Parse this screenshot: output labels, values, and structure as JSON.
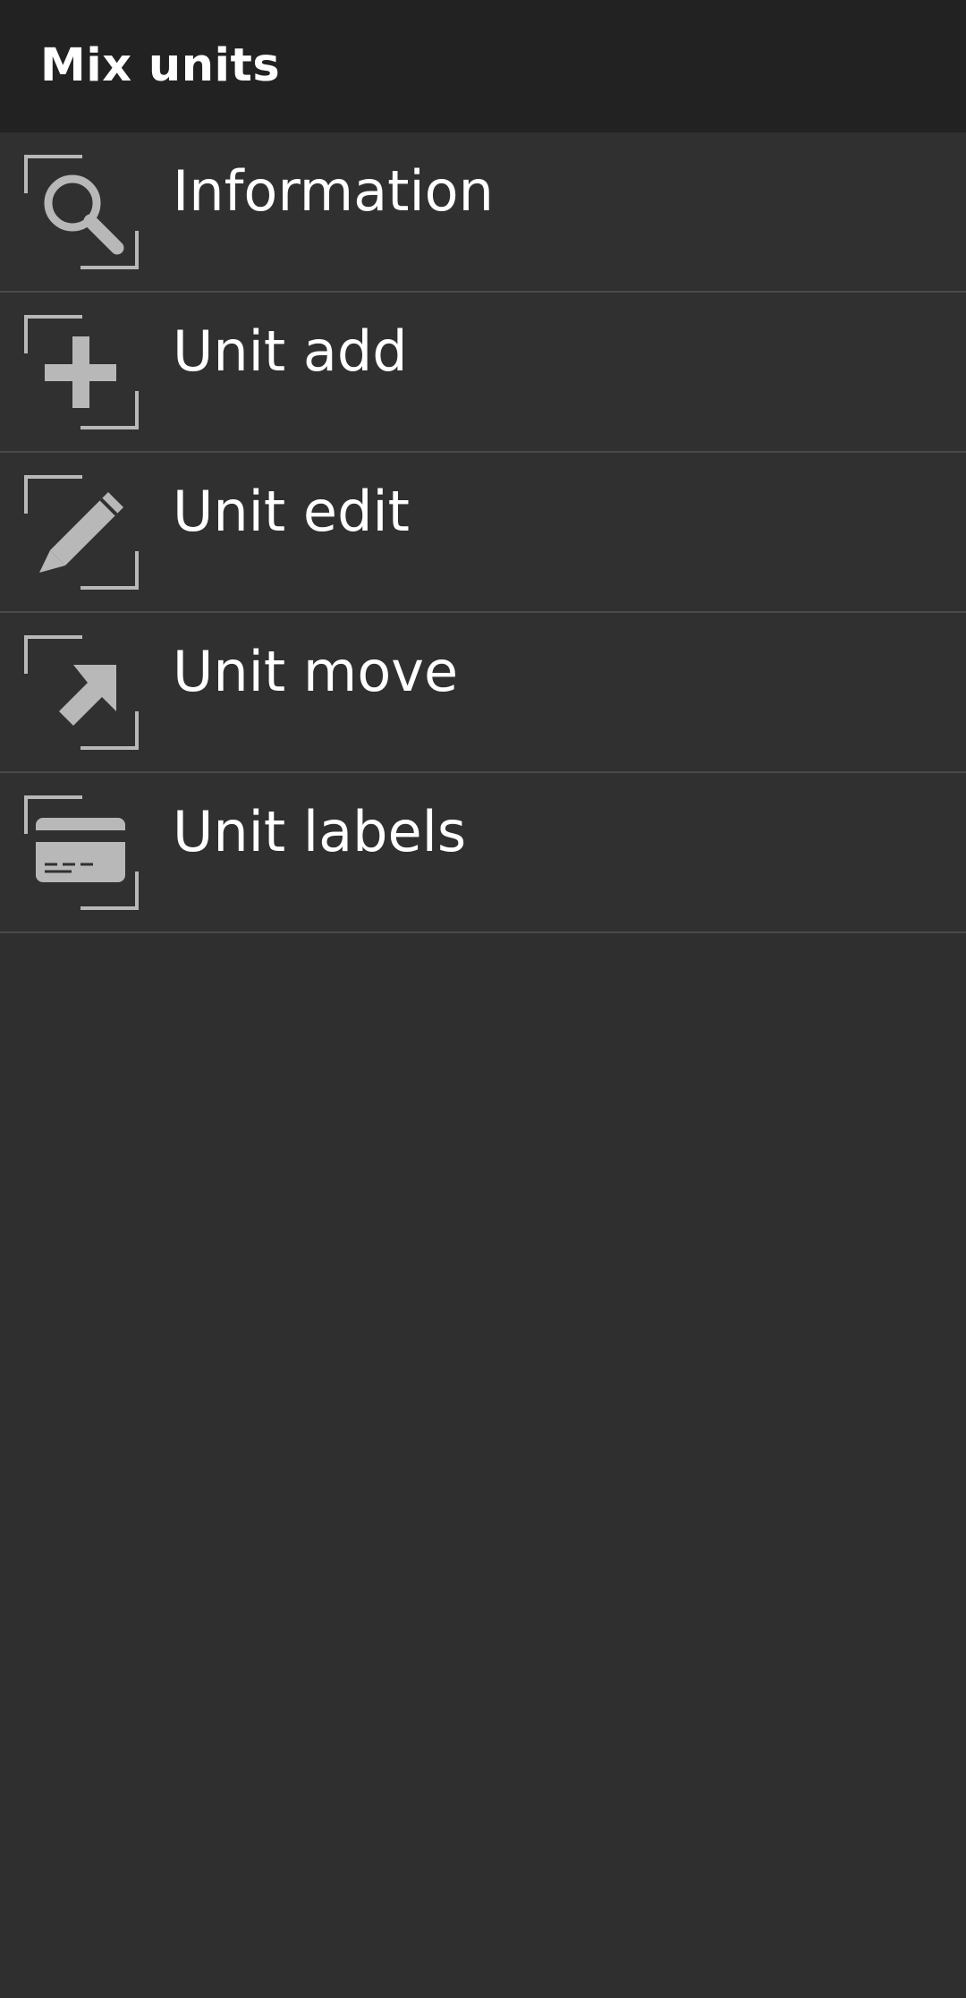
{
  "app_bar": {
    "title": "Mix units"
  },
  "menu": {
    "items": [
      {
        "label": "Information",
        "icon": "search-icon"
      },
      {
        "label": "Unit add",
        "icon": "add-icon"
      },
      {
        "label": "Unit edit",
        "icon": "pencil-icon"
      },
      {
        "label": "Unit move",
        "icon": "move-arrow-icon"
      },
      {
        "label": "Unit labels",
        "icon": "label-card-icon"
      }
    ]
  },
  "colors": {
    "app_bar_bg": "#222222",
    "list_bg": "#303030",
    "divider": "#4a4a4a",
    "icon": "#b8b8b8",
    "text": "#ffffff"
  }
}
